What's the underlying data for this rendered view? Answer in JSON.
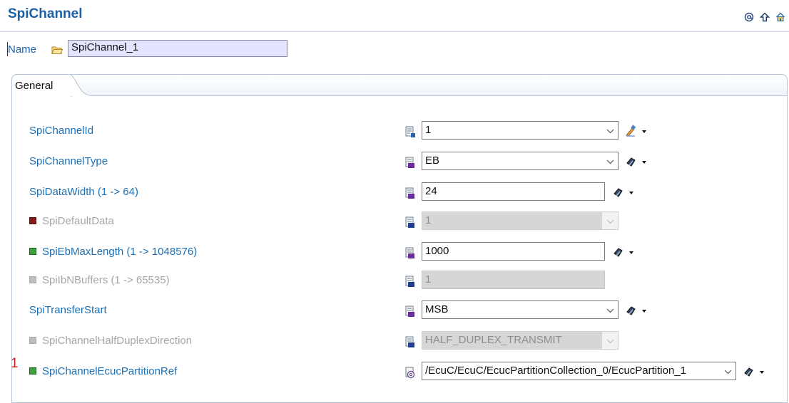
{
  "header": {
    "title": "SpiChannel",
    "icons": [
      "at-icon",
      "up-arrow-icon",
      "home-icon"
    ]
  },
  "name_field": {
    "label": "Name",
    "value": "SpiChannel_1"
  },
  "tabs": [
    {
      "label": "General",
      "active": true
    }
  ],
  "rows": [
    {
      "label": "SpiChannelId",
      "value": "1",
      "control": "combo",
      "enabled": true,
      "marker": null
    },
    {
      "label": "SpiChannelType",
      "value": "EB",
      "control": "combo",
      "enabled": true,
      "marker": null
    },
    {
      "label": "SpiDataWidth (1 -> 64)",
      "value": "24",
      "control": "text",
      "enabled": true,
      "marker": null
    },
    {
      "label": "SpiDefaultData",
      "value": "1",
      "control": "combo",
      "enabled": false,
      "marker": "red"
    },
    {
      "label": "SpiEbMaxLength (1 -> 1048576)",
      "value": "1000",
      "control": "text",
      "enabled": true,
      "marker": "green"
    },
    {
      "label": "SpiIbNBuffers (1 -> 65535)",
      "value": "1",
      "control": "text",
      "enabled": false,
      "marker": "gray"
    },
    {
      "label": "SpiTransferStart",
      "value": "MSB",
      "control": "combo",
      "enabled": true,
      "marker": null
    },
    {
      "label": "SpiChannelHalfDuplexDirection",
      "value": "HALF_DUPLEX_TRANSMIT",
      "control": "combo",
      "enabled": false,
      "marker": "gray"
    },
    {
      "label": "SpiChannelEcucPartitionRef",
      "value": "/EcuC/EcuC/EcucPartitionCollection_0/EcucPartition_1",
      "control": "combo",
      "enabled": true,
      "marker": "green"
    }
  ],
  "error_count": "1",
  "colors": {
    "title": "#1b5fa6",
    "label": "#1b6fb4",
    "disabled_label": "#a6a6a6",
    "name_input_bg": "#e4e4ff",
    "error": "#d21f1f"
  }
}
